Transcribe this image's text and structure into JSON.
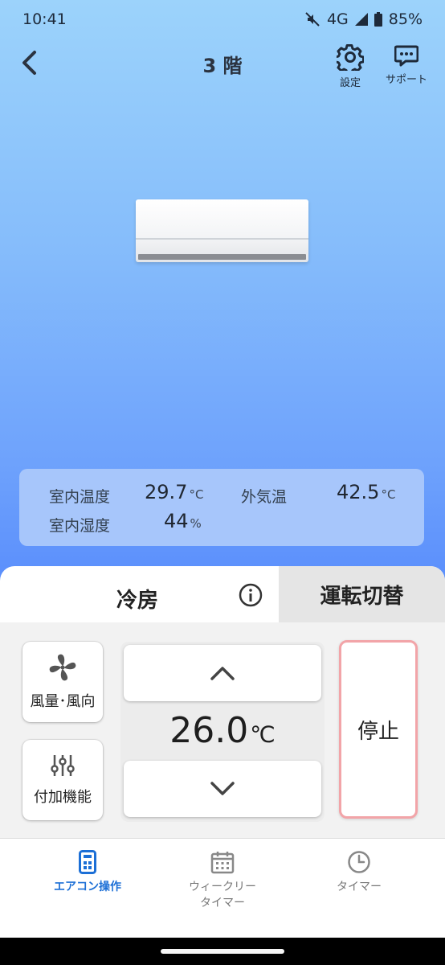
{
  "status_bar": {
    "time": "10:41",
    "network": "4G",
    "battery": "85%"
  },
  "header": {
    "title": "3 階",
    "settings_label": "設定",
    "support_label": "サポート"
  },
  "room_info": {
    "indoor_temp_label": "室内温度",
    "indoor_temp_value": "29.7",
    "indoor_temp_unit": "°C",
    "outdoor_temp_label": "外気温",
    "outdoor_temp_value": "42.5",
    "outdoor_temp_unit": "°C",
    "indoor_humidity_label": "室内湿度",
    "indoor_humidity_value": "44",
    "indoor_humidity_unit": "%"
  },
  "control": {
    "mode": "冷房",
    "mode_switch_label": "運転切替",
    "wind_label": "風量･風向",
    "extra_label": "付加機能",
    "set_temp": "26.0",
    "set_temp_unit": "℃",
    "stop_label": "停止"
  },
  "bottom_nav": {
    "items": [
      {
        "label": "エアコン操作",
        "active": true
      },
      {
        "label": "ウィークリー\nタイマー",
        "active": false
      },
      {
        "label": "タイマー",
        "active": false
      }
    ]
  },
  "colors": {
    "accent": "#1c6fd6",
    "stop_border": "#f2a4a8",
    "panel": "#a7c6fb"
  }
}
